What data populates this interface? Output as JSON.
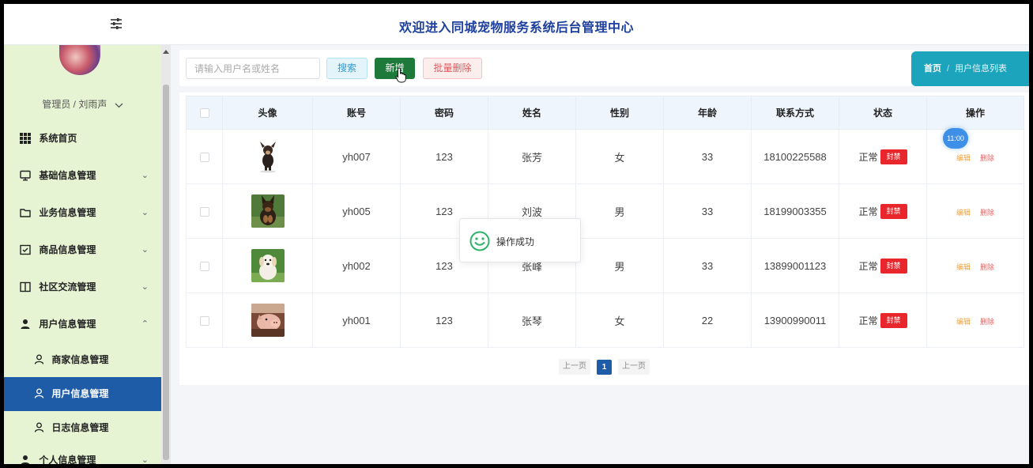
{
  "header": {
    "title": "欢迎进入同城宠物服务系统后台管理中心",
    "toggle_icon": "sliders-icon"
  },
  "sidebar": {
    "admin_label": "管理员 / 刘雨声",
    "items": [
      {
        "label": "系统首页",
        "icon": "grid-icon"
      },
      {
        "label": "基础信息管理",
        "icon": "monitor-icon",
        "chevron": "⌄"
      },
      {
        "label": "业务信息管理",
        "icon": "folder-icon",
        "chevron": "⌄"
      },
      {
        "label": "商品信息管理",
        "icon": "inbox-icon",
        "chevron": "⌄"
      },
      {
        "label": "社区交流管理",
        "icon": "book-icon",
        "chevron": "⌄"
      },
      {
        "label": "用户信息管理",
        "icon": "user-icon",
        "chevron": "⌃"
      }
    ],
    "sub_items": [
      {
        "label": "商家信息管理"
      },
      {
        "label": "用户信息管理"
      },
      {
        "label": "日志信息管理"
      }
    ],
    "personal": {
      "label": "个人信息管理",
      "chevron": "⌄"
    }
  },
  "toolbar": {
    "search_placeholder": "请输入用户名或姓名",
    "search_label": "搜索",
    "add_label": "新增",
    "batch_delete_label": "批量删除"
  },
  "breadcrumb": {
    "home": "首页",
    "separator": "/",
    "current": "用户信息列表"
  },
  "table": {
    "headers": [
      "头像",
      "账号",
      "密码",
      "姓名",
      "性别",
      "年龄",
      "联系方式",
      "状态",
      "操作"
    ],
    "rows": [
      {
        "account": "yh007",
        "password": "123",
        "name": "张芳",
        "gender": "女",
        "age": "33",
        "phone": "18100225588",
        "status": "正常",
        "ban": "封禁",
        "edit": "编辑",
        "delete": "删除",
        "pet": "chihuahua"
      },
      {
        "account": "yh005",
        "password": "123",
        "name": "刘波",
        "gender": "男",
        "age": "33",
        "phone": "18199003355",
        "status": "正常",
        "ban": "封禁",
        "edit": "编辑",
        "delete": "删除",
        "pet": "shepherd"
      },
      {
        "account": "yh002",
        "password": "123",
        "name": "张峰",
        "gender": "男",
        "age": "33",
        "phone": "13899001123",
        "status": "正常",
        "ban": "封禁",
        "edit": "编辑",
        "delete": "删除",
        "pet": "puppy"
      },
      {
        "account": "yh001",
        "password": "123",
        "name": "张琴",
        "gender": "女",
        "age": "22",
        "phone": "13900990011",
        "status": "正常",
        "ban": "封禁",
        "edit": "编辑",
        "delete": "删除",
        "pet": "pig"
      }
    ]
  },
  "pagination": {
    "prev": "上一页",
    "current": "1",
    "next": "上一页"
  },
  "time_badge": "11:00",
  "toast": {
    "message": "操作成功",
    "icon": "smile-icon"
  },
  "colors": {
    "title": "#1d3f9e",
    "active_menu": "#1f5ca8",
    "breadcrumb_bg": "#1da4bd",
    "add_button": "#1e7a3a",
    "ban_button": "#e8262b",
    "sidebar_bg": "#e7f4d4"
  }
}
